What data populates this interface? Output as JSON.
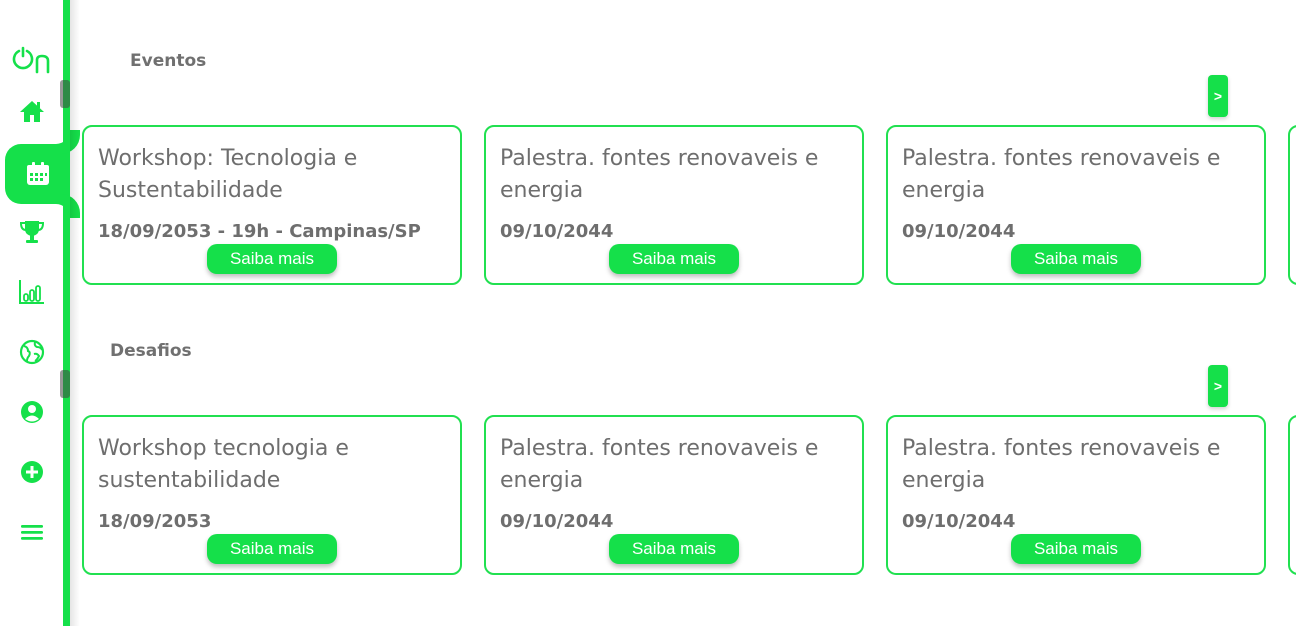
{
  "brand": {
    "logo_text": "On",
    "accent": "#15e04a"
  },
  "sidebar": {
    "items": [
      {
        "icon": "home-icon"
      },
      {
        "icon": "calendar-icon",
        "active": true
      },
      {
        "icon": "trophy-icon"
      },
      {
        "icon": "bar-chart-icon"
      },
      {
        "icon": "globe-icon"
      },
      {
        "icon": "user-icon"
      },
      {
        "icon": "plus-circle-icon"
      },
      {
        "icon": "menu-icon"
      }
    ]
  },
  "eventos": {
    "title": "Eventos",
    "next_label": ">",
    "cards": [
      {
        "title": "Workshop: Tecnologia e Sustentabilidade",
        "date": "18/09/2053 - 19h - Campinas/SP",
        "button": "Saiba mais"
      },
      {
        "title": "Palestra. fontes renovaveis e energia",
        "date": "09/10/2044",
        "button": "Saiba mais"
      },
      {
        "title": "Palestra. fontes renovaveis e energia",
        "date": "09/10/2044",
        "button": "Saiba mais"
      }
    ]
  },
  "desafios": {
    "title": "Desafios",
    "next_label": ">",
    "cards": [
      {
        "title": "Workshop tecnologia e sustentabilidade",
        "date": "18/09/2053",
        "button": "Saiba mais"
      },
      {
        "title": "Palestra. fontes renovaveis e energia",
        "date": "09/10/2044",
        "button": "Saiba mais"
      },
      {
        "title": "Palestra. fontes renovaveis e energia",
        "date": "09/10/2044",
        "button": "Saiba mais"
      }
    ]
  }
}
